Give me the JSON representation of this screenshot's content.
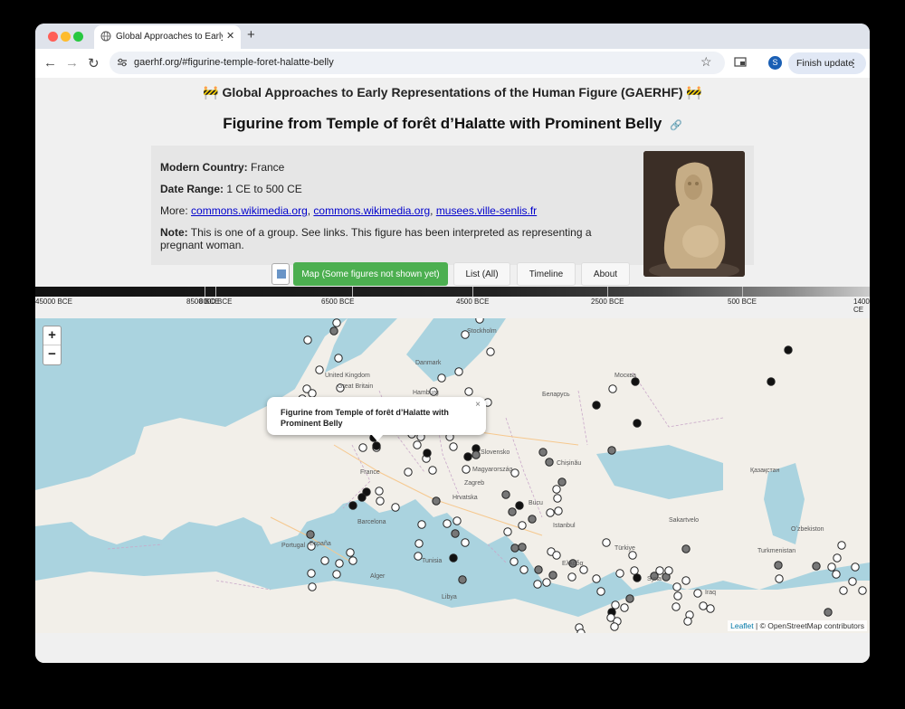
{
  "browser": {
    "tab_title": "Global Approaches to Early R",
    "url": "gaerhf.org/#figurine-temple-foret-halatte-belly",
    "profile_initial": "S",
    "finish_update_label": "Finish update"
  },
  "page": {
    "site_title": "🚧 Global Approaches to Early Representations of the Human Figure (GAERHF) 🚧",
    "figure_title": "Figurine from Temple of forêt d’Halatte with Prominent Belly",
    "permalink_icon": "🔗",
    "country_label": "Modern Country:",
    "country_value": "France",
    "date_label": "Date Range:",
    "date_value": "1 CE to 500 CE",
    "more_label": "More:",
    "links": [
      "commons.wikimedia.org",
      "commons.wikimedia.org",
      "musees.ville-senlis.fr"
    ],
    "note_label": "Note:",
    "note_text": "This is one of a group. See links. This figure has been interpreted as representing a pregnant woman."
  },
  "nav_buttons": {
    "map": "Map (Some figures not shown yet)",
    "list": "List (All)",
    "timeline": "Timeline",
    "about": "About"
  },
  "timeline_labels": [
    "45000 BCE",
    "8500 BCE",
    "8000 BCE",
    "6500 BCE",
    "4500 BCE",
    "2500 BCE",
    "500 BCE",
    "1400 CE"
  ],
  "map": {
    "zoom_in": "+",
    "zoom_out": "−",
    "popup_title": "Figurine from Temple of forêt d’Halatte with Prominent Belly",
    "popup_close": "×",
    "attribution_leaflet": "Leaflet",
    "attribution_osm": "| © OpenStreetMap contributors",
    "place_labels": [
      "Stockholm",
      "United Kingdom",
      "Great Britain",
      "Danmark",
      "Hamburg",
      "Москва",
      "Беларусь",
      "France",
      "Slovensko",
      "Magyarország",
      "Chișinău",
      "Zagreb",
      "Hrvatska",
      "Bucu",
      "Barcelona",
      "España",
      "Portugal",
      "Istanbul",
      "Türkiye",
      "Sakartvelo",
      "Қазақстан",
      "Oʻzbekiston",
      "Turkmenistan",
      "Alger",
      "Tunisia",
      "Ελλάδα",
      "Libya",
      "Syria",
      "Iraq"
    ]
  },
  "colors": {
    "map_button_active": "#4caf50",
    "link": "#0000cc",
    "sea": "#aad3df",
    "land": "#f2efe9"
  }
}
